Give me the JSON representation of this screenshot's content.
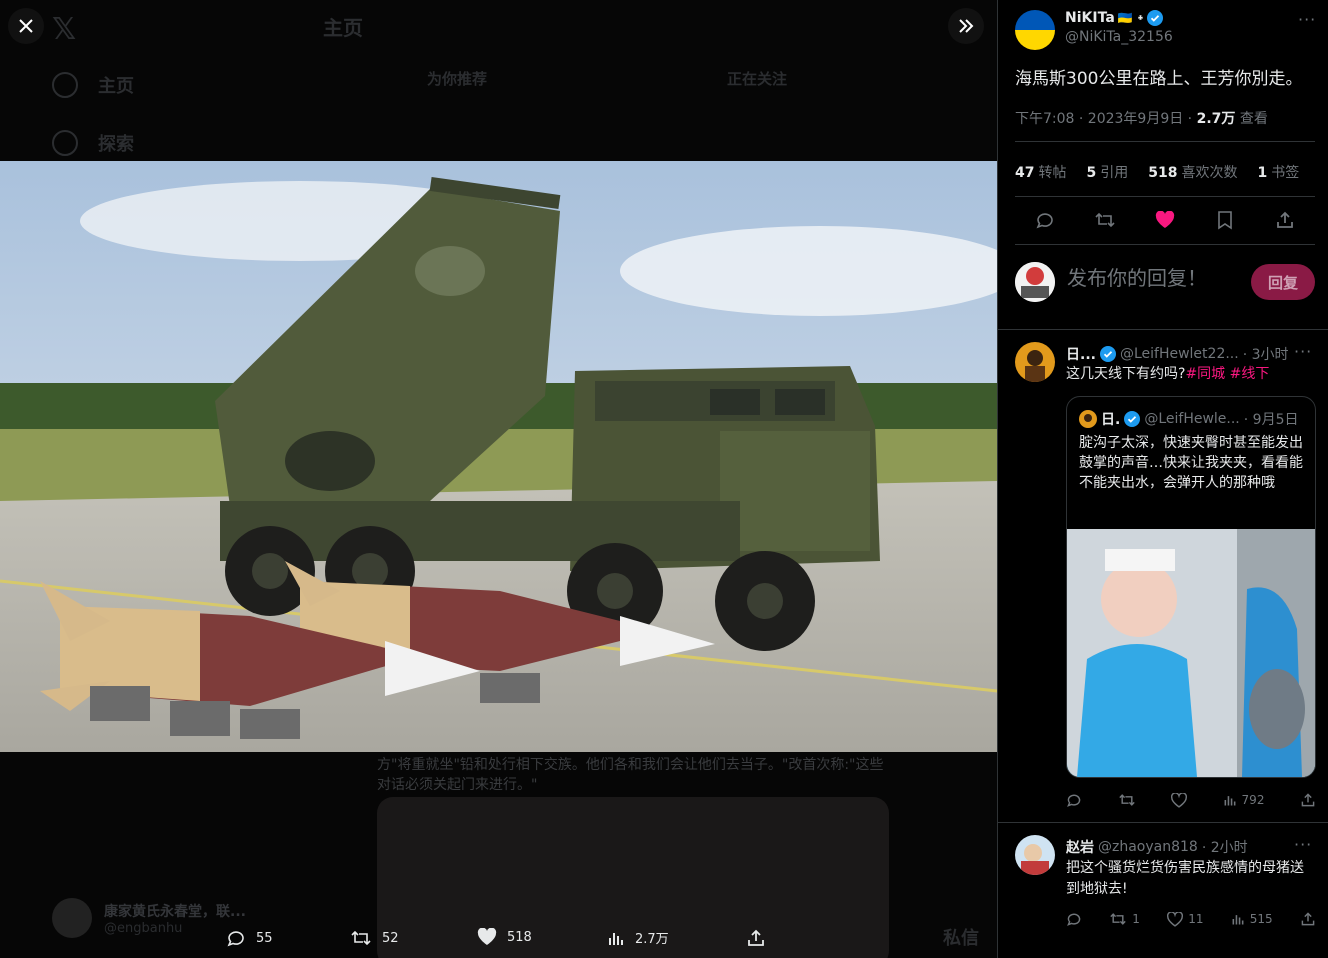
{
  "viewer": {
    "bg_nav": {
      "home": "主页",
      "explore": "探索",
      "header_title": "主页",
      "tab_for_you": "为你推荐",
      "tab_following": "正在关注"
    },
    "bg_text": "方\"将重就坐\"铅和处行相下交族。他们各和我们会让他们去当子。\"改首次称:\"这些对话必须关起门来进行。\"",
    "bg_user": {
      "name": "康家黄氏永春堂，联...",
      "handle": "@engbanhu",
      "dm": "私信"
    },
    "bottom_stats": {
      "replies": "55",
      "retweets": "52",
      "likes": "518",
      "views": "2.7万"
    }
  },
  "tweet": {
    "author_name": "NiKITa",
    "author_flags": "🇺🇦 ᛭",
    "author_handle": "@NiKiTa_32156",
    "text": "海馬斯300公里在路上、王芳你別走。",
    "time": "下午7:08 · 2023年9月9日 · ",
    "views_count": "2.7万",
    "views_label": " 查看",
    "stats": [
      {
        "count": "47",
        "label": "转帖"
      },
      {
        "count": "5",
        "label": "引用"
      },
      {
        "count": "518",
        "label": "喜欢次数"
      },
      {
        "count": "1",
        "label": "书签"
      }
    ],
    "reply_placeholder": "发布你的回复！",
    "reply_button": "回复"
  },
  "replies": [
    {
      "name": "日...",
      "handle": "@LeifHewlet22...",
      "time": "· 3小时",
      "text": "这几天线下有约吗?",
      "tags": "#同城 #线下",
      "quote": {
        "name": "日.",
        "handle": "@LeifHewle...",
        "time": "· 9月5日",
        "text": "腚沟子太深，快速夹臀时甚至能发出鼓掌的声音…快来让我夹夹，看看能不能夹出水，会弹开人的那种哦"
      },
      "views": "792"
    },
    {
      "name": "赵岩",
      "handle": "@zhaoyan818",
      "time": "· 2小时",
      "text": "把这个骚货烂货伤害民族感情的母猪送到地狱去!",
      "retweets": "1",
      "likes": "11",
      "views": "515"
    }
  ],
  "colors": {
    "accent": "#1d9bf0",
    "like": "#f91880",
    "reply_btn": "#8a1a45"
  }
}
